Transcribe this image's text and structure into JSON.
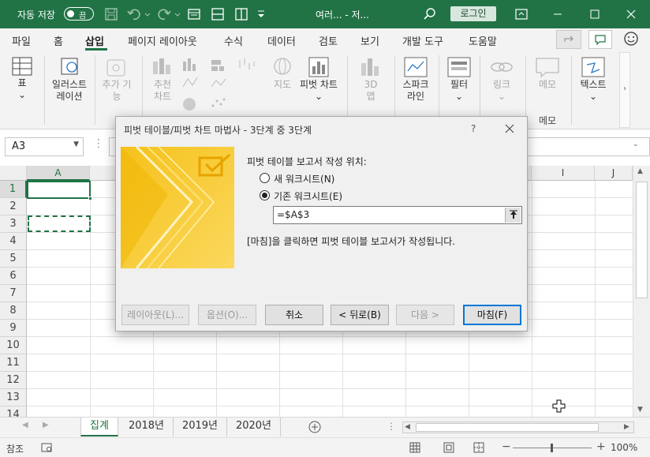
{
  "titlebar": {
    "autosave_label": "자동 저장",
    "autosave_state": "끔",
    "doc_title": "여러... - 저...",
    "login_label": "로그인"
  },
  "tabs": [
    "파일",
    "홈",
    "삽입",
    "페이지 레이아웃",
    "수식",
    "데이터",
    "검토",
    "보기",
    "개발 도구",
    "도움말"
  ],
  "active_tab": "삽입",
  "ribbon": {
    "table": "표",
    "illustrations": [
      "일러스트",
      "레이션"
    ],
    "addins": [
      "추가 기",
      "능"
    ],
    "recommended_charts": [
      "추천",
      "차트"
    ],
    "maps": "지도",
    "pivot_chart": "피벗 차트",
    "threed_map": [
      "3D",
      "맵"
    ],
    "sparklines": [
      "스파크",
      "라인"
    ],
    "filters": "필터",
    "link": "링크",
    "comment": "메모",
    "comment_group": "메모",
    "text": "텍스트"
  },
  "namebox": "A3",
  "columns": [
    "A",
    "I",
    "J"
  ],
  "rows": [
    "1",
    "2",
    "3",
    "4",
    "5",
    "6",
    "7",
    "8",
    "9",
    "10",
    "11",
    "12",
    "13",
    "14"
  ],
  "sheets": {
    "active": "집계",
    "items": [
      "2018년",
      "2019년",
      "2020년"
    ]
  },
  "status": {
    "mode": "참조",
    "zoom": "100%"
  },
  "dialog": {
    "title": "피벗 테이블/피벗 차트 마법사 - 3단계 중 3단계",
    "help": "?",
    "prompt": "피벗 테이블 보고서 작성 위치:",
    "option_new": "새 워크시트(N)",
    "option_existing": "기존 워크시트(E)",
    "selected_option": "기존 워크시트(E)",
    "location_value": "=$A$3",
    "info": "[마침]을 클릭하면 피벗 테이블 보고서가 작성됩니다.",
    "buttons": {
      "layout": "레이아웃(L)...",
      "options": "옵션(O)...",
      "cancel": "취소",
      "back": "< 뒤로(B)",
      "next": "다음 >",
      "finish": "마침(F)"
    }
  },
  "colors": {
    "brand": "#217346",
    "accent_blue": "#0078d7",
    "wizard_yellow": "#f7c72a"
  }
}
